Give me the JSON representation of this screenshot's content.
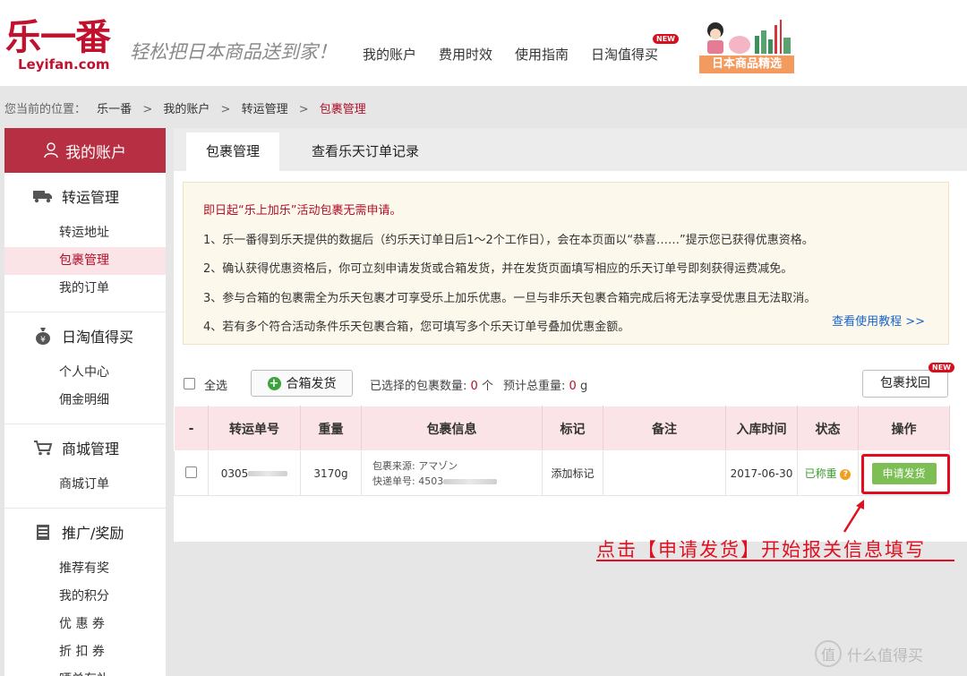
{
  "brand": {
    "logo_text": "乐一番",
    "logo_domain": "Leyifan.com",
    "slogan": "轻松把日本商品送到家！",
    "promo_label": "日本商品精选",
    "color_primary": "#b62f43"
  },
  "nav": {
    "items": [
      "我的账户",
      "费用时效",
      "使用指南",
      "日淘值得买"
    ],
    "new_badge": "NEW"
  },
  "breadcrumb": {
    "prefix": "您当前的位置：",
    "items": [
      "乐一番",
      "我的账户",
      "转运管理",
      "包裹管理"
    ],
    "separator": ">"
  },
  "sidebar": {
    "header": "我的账户",
    "sections": [
      {
        "title": "转运管理",
        "items": [
          "转运地址",
          "包裹管理",
          "我的订单"
        ]
      },
      {
        "title": "日淘值得买",
        "items": [
          "个人中心",
          "佣金明细"
        ]
      },
      {
        "title": "商城管理",
        "items": [
          "商城订单"
        ]
      },
      {
        "title": "推广/奖励",
        "items": [
          "推荐有奖",
          "我的积分",
          "优 惠 券",
          "折 扣 券",
          "晒单有礼"
        ]
      }
    ],
    "active_item": "包裹管理"
  },
  "tabs": [
    "包裹管理",
    "查看乐天订单记录"
  ],
  "notice": {
    "headline": "即日起“乐上加乐”活动包裹无需申请。",
    "lines": [
      "1、乐一番得到乐天提供的数据后（约乐天订单日后1～2个工作日），会在本页面以“恭喜……”提示您已获得优惠资格。",
      "2、确认获得优惠资格后，你可立刻申请发货或合箱发货，并在发货页面填写相应的乐天订单号即刻获得运费减免。",
      "3、参与合箱的包裹需全为乐天包裹才可享受乐上加乐优惠。一旦与非乐天包裹合箱完成后将无法享受优惠且无法取消。",
      "4、若有多个符合活动条件乐天包裹合箱，您可填写多个乐天订单号叠加优惠金额。"
    ],
    "link": "查看使用教程 >>"
  },
  "toolbar": {
    "select_all": "全选",
    "merge_button": "合箱发货",
    "selected_count_label": "已选择的包裹数量:",
    "selected_count": "0",
    "selected_count_unit": "个",
    "weight_label": "预计总重量:",
    "weight_value": "0",
    "weight_unit": "g",
    "find_button": "包裹找回",
    "find_new": "NEW"
  },
  "table": {
    "headers": [
      "-",
      "转运单号",
      "重量",
      "包裹信息",
      "标记",
      "备注",
      "入库时间",
      "状态",
      "操作"
    ],
    "rows": [
      {
        "tracking_prefix": "0305",
        "weight": "3170g",
        "source_label": "包裹来源: アマゾン",
        "express_label": "快递单号: 4503",
        "mark": "添加标记",
        "note": "",
        "date": "2017-06-30",
        "status": "已称重",
        "action": "申请发货"
      }
    ]
  },
  "annotation": "点击【申请发货】开始报关信息填写",
  "watermark": "什么值得买"
}
